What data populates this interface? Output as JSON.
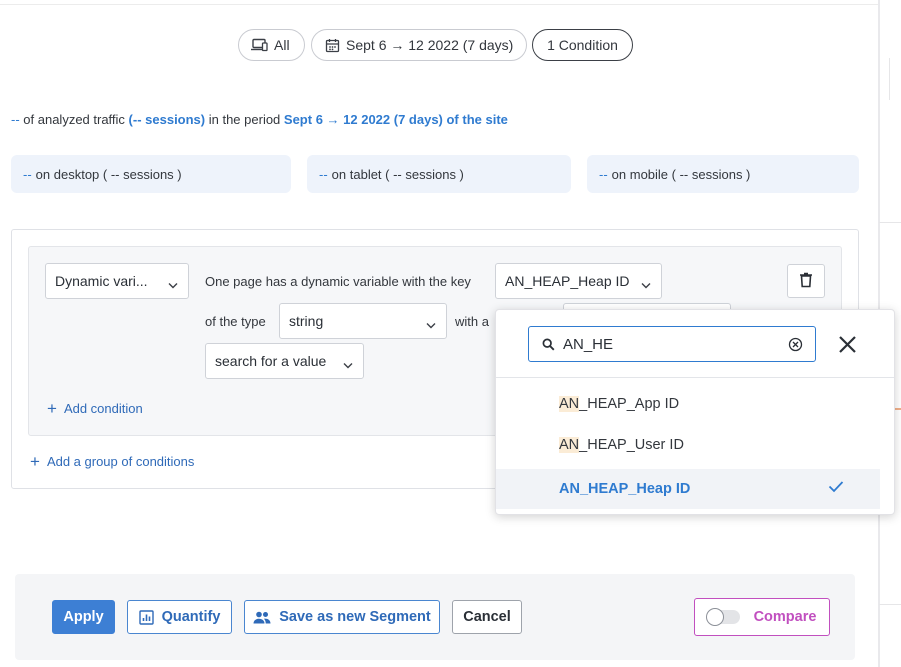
{
  "filters": {
    "device_label": "All",
    "period_label": "Sept 6 → 12 2022 (7 days)",
    "condition_label": "1 Condition"
  },
  "summary": {
    "prefix": "--",
    "part1": " of analyzed traffic ",
    "sessions": "(-- sessions)",
    "part2": " in the period ",
    "period": "Sept 6 → 12 2022 (7 days) of the site"
  },
  "devices": [
    {
      "dash": "--",
      "label": "on desktop ( -- sessions )"
    },
    {
      "dash": "--",
      "label": "on tablet ( -- sessions )"
    },
    {
      "dash": "--",
      "label": "on mobile ( -- sessions )"
    }
  ],
  "condition": {
    "type_select": "Dynamic vari...",
    "sentence_start": "One page has a dynamic variable with the key",
    "key_select": "AN_HEAP_Heap ID",
    "of_type": "of the type",
    "type_value": "string",
    "with_a": "with a",
    "value_select": "search for a value",
    "add_condition": "Add condition",
    "add_group": "Add a group of conditions"
  },
  "dropdown": {
    "search_value": "AN_HE",
    "options": [
      {
        "match": "AN",
        "rest": "_HEAP_App ID"
      },
      {
        "match": "AN",
        "rest": "_HEAP_User ID"
      },
      {
        "match": "AN",
        "rest": "_HEAP_Heap ID",
        "selected": true
      }
    ]
  },
  "footer": {
    "apply": "Apply",
    "quantify": "Quantify",
    "save_segment": "Save as new Segment",
    "cancel": "Cancel",
    "compare": "Compare"
  },
  "colors": {
    "accent": "#2f7bd0",
    "primary_button": "#3d7fd4",
    "compare": "#c14fbf",
    "match_highlight": "#fbecd6"
  }
}
